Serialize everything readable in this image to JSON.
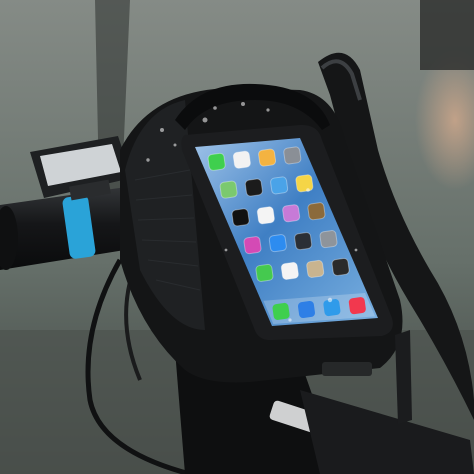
{
  "scene": {
    "subject": "bike-handlebar-phone-bag",
    "colors": {
      "background_top": "#7c827d",
      "background_bottom": "#4a504c",
      "bag": "#141516",
      "screen": "#3f7fc4",
      "accent_band": "#2aa3d8"
    }
  },
  "phone": {
    "app_icons": [
      {
        "name": "messages-icon",
        "color": "#3fcf4e"
      },
      {
        "name": "calendar-icon",
        "color": "#f2f2f2"
      },
      {
        "name": "photos-icon",
        "color": "#f4b341"
      },
      {
        "name": "camera-icon",
        "color": "#8a8f96"
      },
      {
        "name": "maps-icon",
        "color": "#7bc96f"
      },
      {
        "name": "clock-icon",
        "color": "#1b1b1b"
      },
      {
        "name": "weather-icon",
        "color": "#4aa3e8"
      },
      {
        "name": "notes-icon",
        "color": "#f5d547"
      },
      {
        "name": "stocks-icon",
        "color": "#111111"
      },
      {
        "name": "reminders-icon",
        "color": "#f4f4f4"
      },
      {
        "name": "game-center-icon",
        "color": "#c77ad7"
      },
      {
        "name": "newsstand-icon",
        "color": "#8b6a3b"
      },
      {
        "name": "itunes-icon",
        "color": "#d44ab5"
      },
      {
        "name": "app-store-icon",
        "color": "#2d8cf0"
      },
      {
        "name": "passbook-icon",
        "color": "#2b2f35"
      },
      {
        "name": "settings-icon",
        "color": "#8e949b"
      },
      {
        "name": "facetime-icon",
        "color": "#45c94f"
      },
      {
        "name": "health-icon",
        "color": "#f4f4f4"
      },
      {
        "name": "contacts-icon",
        "color": "#c9b48f"
      },
      {
        "name": "calculator-icon",
        "color": "#2a2a2a"
      }
    ],
    "dock_icons": [
      {
        "name": "phone-icon",
        "color": "#3fcf4e"
      },
      {
        "name": "mail-icon",
        "color": "#2e7fe6"
      },
      {
        "name": "safari-icon",
        "color": "#2f9bea"
      },
      {
        "name": "music-icon",
        "color": "#f2384e"
      }
    ]
  }
}
